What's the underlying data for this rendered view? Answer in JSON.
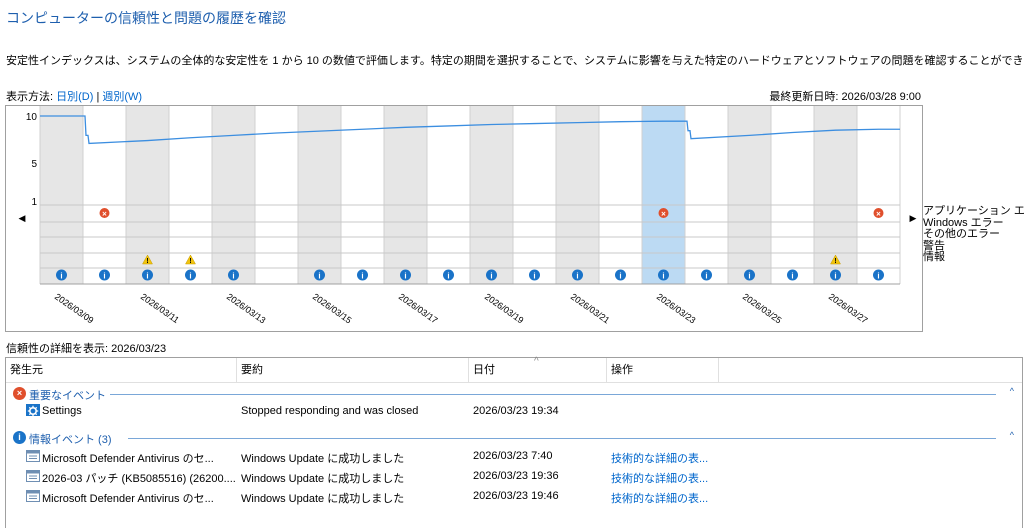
{
  "title": "コンピューターの信頼性と問題の履歴を確認",
  "description": "安定性インデックスは、システムの全体的な安定性を 1 から 10 の数値で評価します。特定の期間を選択することで、システムに影響を与えた特定のハードウェアとソフトウェアの問題を確認することができます。",
  "view_by": {
    "label": "表示方法:",
    "daily": "日別(D)",
    "separator": "|",
    "weekly": "週別(W)"
  },
  "last_updated": "最終更新日時: 2026/03/28 9:00",
  "chart": {
    "y_ticks": [
      "10",
      "5",
      "1"
    ],
    "dates": [
      "2026/03/09",
      "2026/03/11",
      "2026/03/13",
      "2026/03/15",
      "2026/03/17",
      "2026/03/19",
      "2026/03/21",
      "2026/03/23",
      "2026/03/25",
      "2026/03/27"
    ],
    "legend": [
      "アプリケーション エラー",
      "Windows エラー",
      "その他のエラー",
      "警告",
      "情報"
    ],
    "selected_day_index": 14
  },
  "chart_data": {
    "type": "line",
    "y_range": [
      1,
      10
    ],
    "x": [
      "2026/03/09",
      "2026/03/10",
      "2026/03/11",
      "2026/03/12",
      "2026/03/13",
      "2026/03/14",
      "2026/03/15",
      "2026/03/16",
      "2026/03/17",
      "2026/03/18",
      "2026/03/19",
      "2026/03/20",
      "2026/03/21",
      "2026/03/22",
      "2026/03/23",
      "2026/03/24",
      "2026/03/25",
      "2026/03/26",
      "2026/03/27",
      "2026/03/28"
    ],
    "stability_index": [
      10,
      7.1,
      7.4,
      7.7,
      7.95,
      8.2,
      8.4,
      8.6,
      8.8,
      8.95,
      9.1,
      9.2,
      9.3,
      9.4,
      9.45,
      7.6,
      7.95,
      8.25,
      8.5,
      8.6
    ],
    "application_errors_days": [
      1,
      14,
      19
    ],
    "warnings_days": [
      2,
      3,
      18
    ],
    "info_days": [
      0,
      1,
      2,
      3,
      4,
      6,
      7,
      8,
      9,
      10,
      11,
      12,
      13,
      14,
      15,
      16,
      17,
      18,
      19
    ]
  },
  "detail_label": "信頼性の詳細を表示: 2026/03/23",
  "table": {
    "headers": [
      "発生元",
      "要約",
      "日付",
      "操作"
    ],
    "critical_group": "重要なイベント",
    "info_group": "情報イベント (3)",
    "rows": [
      {
        "source": "Settings",
        "summary": "Stopped responding and was closed",
        "date": "2026/03/23 19:34",
        "action": ""
      },
      {
        "source": "Microsoft Defender Antivirus のセ...",
        "summary": "Windows Update に成功しました",
        "date": "2026/03/23 7:40",
        "action": "技術的な詳細の表..."
      },
      {
        "source": "2026-03 パッチ (KB5085516) (26200....",
        "summary": "Windows Update に成功しました",
        "date": "2026/03/23 19:36",
        "action": "技術的な詳細の表..."
      },
      {
        "source": "Microsoft Defender Antivirus のセ...",
        "summary": "Windows Update に成功しました",
        "date": "2026/03/23 19:46",
        "action": "技術的な詳細の表..."
      }
    ]
  },
  "colors": {
    "accent": "#1e5fae",
    "line": "#3c8ee0",
    "error": "#e04f2c",
    "warning": "#f1c40f",
    "info": "#1a73c8",
    "selected": "#bcdaf3"
  }
}
